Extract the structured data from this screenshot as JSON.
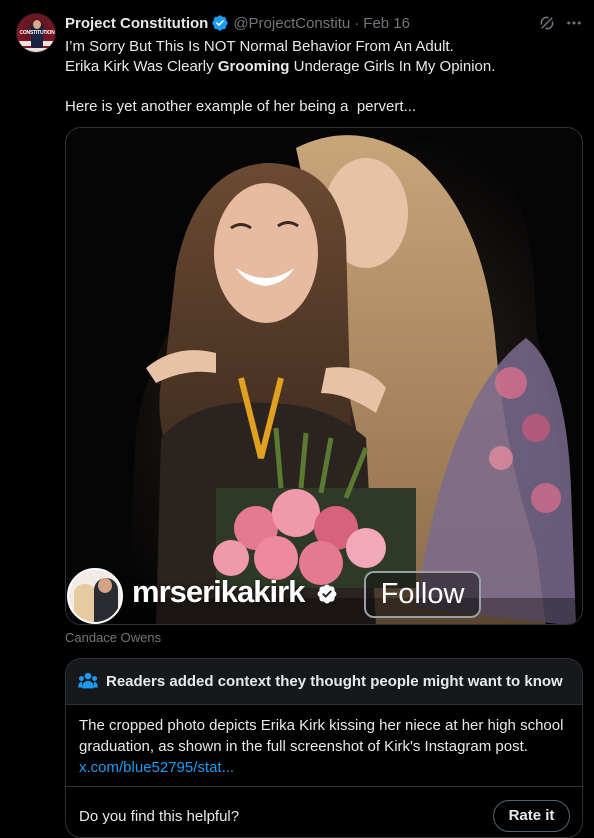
{
  "author": {
    "display_name": "Project Constitution",
    "handle": "@ProjectConstitu",
    "separator": "·",
    "date": "Feb 16",
    "avatar_text": "CONSTITUTION"
  },
  "tweet": {
    "line1": "I’m Sorry But This Is NOT Normal Behavior From An Adult.",
    "line2_before": "Erika Kirk Was Clearly ",
    "line2_bold": "Grooming",
    "line2_after": " Underage Girls In My Opinion.",
    "line3": "Here is yet another example of her being a  pervert..."
  },
  "media": {
    "ig_username": "mrserikakirk",
    "ig_follow_label": "Follow",
    "caption": "Candace Owens"
  },
  "community_note": {
    "title": "Readers added context they thought people might want to know",
    "body": "The cropped photo depicts Erika Kirk kissing her niece at her high school graduation, as shown in the full screenshot of Kirk's Instagram post. ",
    "link": "x.com/blue52795/stat...",
    "helpful_prompt": "Do you find this helpful?",
    "rate_label": "Rate it"
  },
  "icons": {
    "verified": "verified-badge-icon",
    "grok": "grok-icon",
    "more": "more-options-icon",
    "note": "people-icon"
  },
  "colors": {
    "background": "#000000",
    "text": "#e7e9ea",
    "muted": "#71767b",
    "link": "#1d9bf0",
    "border": "#2f3336",
    "verified": "#1d9bf0"
  }
}
